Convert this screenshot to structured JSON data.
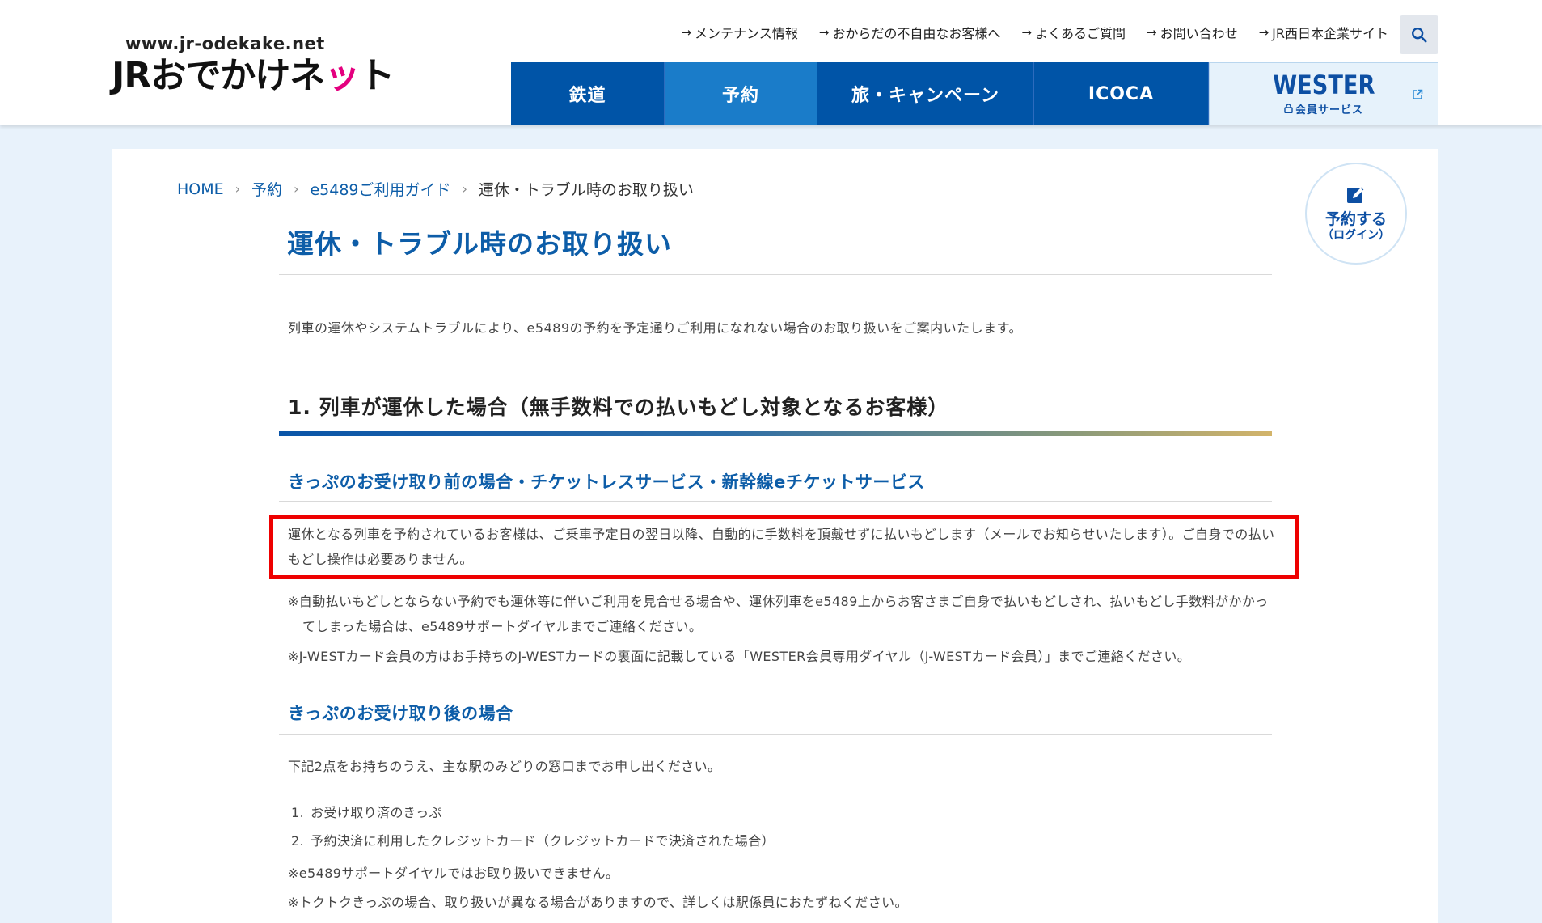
{
  "header": {
    "logo_url": "www.jr-odekake.net",
    "logo_text_part1": "JRおでか",
    "logo_text_part2": "け",
    "logo_text_part3": "ネ",
    "logo_text_part4": "ッ",
    "logo_text_part5": "ト",
    "util_links": [
      "メンテナンス情報",
      "おからだの不自由なお客様へ",
      "よくあるご質問",
      "お問い合わせ",
      "JR西日本企業サイト"
    ],
    "search_icon": "search-icon",
    "gnav": [
      "鉄道",
      "予約",
      "旅・キャンペーン",
      "ICOCA"
    ],
    "wester": {
      "title": "WESTER",
      "sub": "会員サービス",
      "lock_icon": "lock-icon",
      "external_icon": "external-link-icon"
    }
  },
  "breadcrumb": [
    "HOME",
    "予約",
    "e5489ご利用ガイド",
    "運休・トラブル時のお取り扱い"
  ],
  "reserve_button": {
    "line1": "予約する",
    "line2": "（ログイン）",
    "icon": "pen-icon"
  },
  "main": {
    "title": "運休・トラブル時のお取り扱い",
    "intro": "列車の運休やシステムトラブルにより、e5489の予約を予定通りご利用になれない場合のお取り扱いをご案内いたします。",
    "section1": {
      "heading": "1. 列車が運休した場合（無手数料での払いもどし対象となるお客様）",
      "sub_a": {
        "heading": "きっぷのお受け取り前の場合・チケットレスサービス・新幹線eチケットサービス",
        "para": "運休となる列車を予約されているお客様は、ご乗車予定日の翌日以降、自動的に手数料を頂戴せずに払いもどします（メールでお知らせいたします）。ご自身での払いもどし操作は必要ありません。",
        "note1": "※自動払いもどしとならない予約でも運休等に伴いご利用を見合せる場合や、運休列車をe5489上からお客さまご自身で払いもどしされ、払いもどし手数料がかかってしまった場合は、e5489サポートダイヤルまでご連絡ください。",
        "note2": "※J-WESTカード会員の方はお手持ちのJ-WESTカードの裏面に記載している「WESTER会員専用ダイヤル（J-WESTカード会員）」までご連絡ください。"
      },
      "sub_b": {
        "heading": "きっぷのお受け取り後の場合",
        "para": "下記2点をお持ちのうえ、主な駅のみどりの窓口までお申し出ください。",
        "list": [
          {
            "num": "1.",
            "text": "お受け取り済のきっぷ"
          },
          {
            "num": "2.",
            "text": "予約決済に利用したクレジットカード（クレジットカードで決済された場合）"
          }
        ],
        "note3": "※e5489サポートダイヤルではお取り扱いできません。",
        "note4": "※トクトクきっぷの場合、取り扱いが異なる場合がありますので、詳しくは駅係員におたずねください。"
      }
    }
  },
  "colors": {
    "nav_blue": "#0054a7",
    "nav_active": "#1a7cc9",
    "title_blue": "#0d5da8",
    "highlight_red": "#ee0000",
    "page_bg": "#e8f2fb"
  }
}
